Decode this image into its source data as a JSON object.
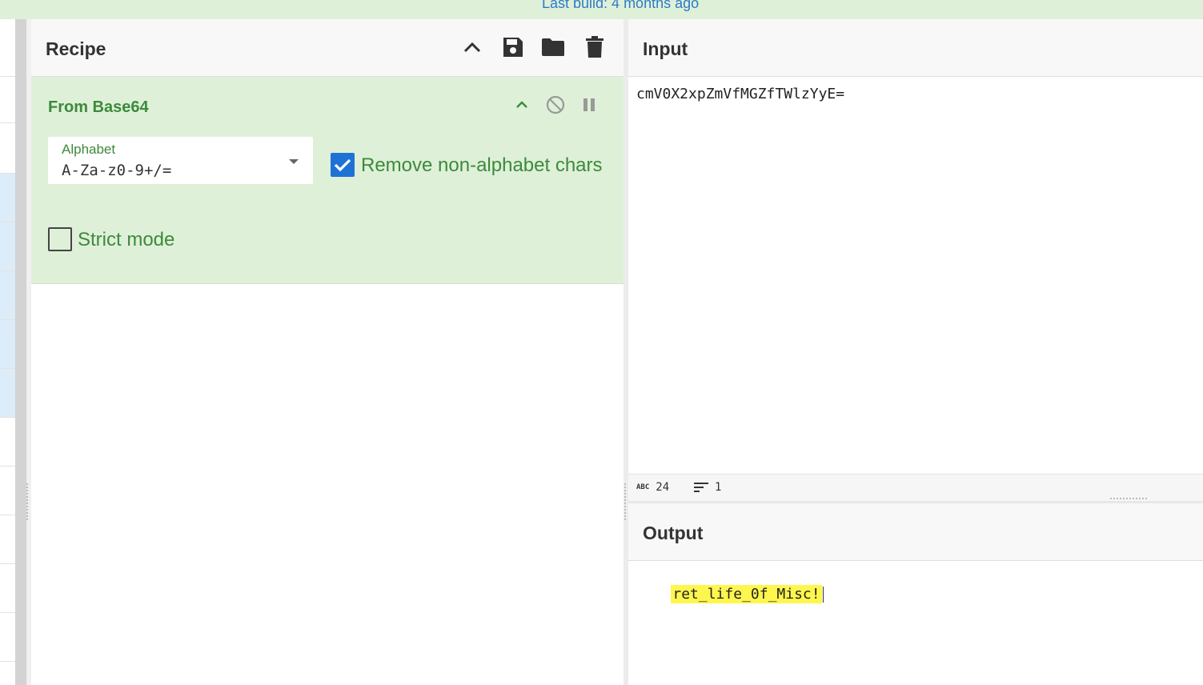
{
  "banner": {
    "text": "Last build: 4 months ago"
  },
  "recipe": {
    "title": "Recipe",
    "header_icons": [
      "chevron-up-icon",
      "save-icon",
      "folder-open-icon",
      "trash-icon"
    ],
    "operation": {
      "name": "From Base64",
      "alphabet": {
        "label": "Alphabet",
        "value": "A-Za-z0-9+/="
      },
      "remove_non_alphabet": {
        "label": "Remove non-alphabet chars",
        "checked": true
      },
      "strict_mode": {
        "label": "Strict mode",
        "checked": false
      }
    }
  },
  "input": {
    "title": "Input",
    "text": "cmV0X2xpZmVfMGZfTWlzYyE=",
    "status": {
      "length": "24",
      "lines": "1"
    }
  },
  "output": {
    "title": "Output",
    "text": "ret_life_0f_Misc!"
  },
  "colors": {
    "accent_green": "#3c8a3c",
    "checkbox_blue": "#1e72d6",
    "highlight": "#fff64d"
  }
}
